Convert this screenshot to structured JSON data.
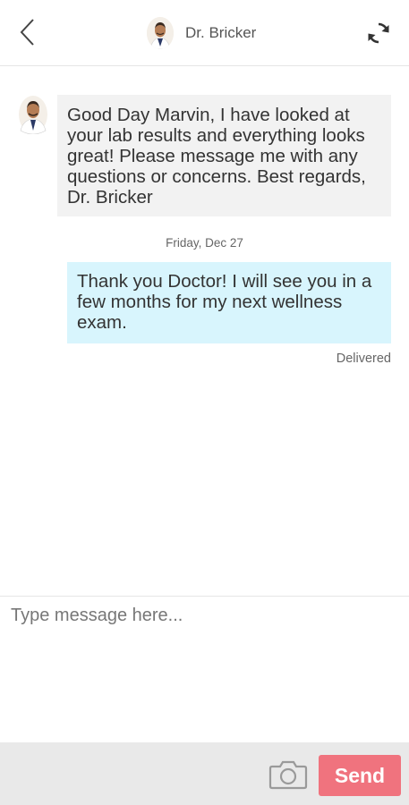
{
  "header": {
    "title": "Dr. Bricker",
    "back_icon": "chevron-left-icon",
    "refresh_icon": "refresh-icon"
  },
  "messages": [
    {
      "direction": "incoming",
      "text": "Good Day Marvin, I have looked at your lab results and everything looks great! Please message me with any questions or concerns. Best regards, Dr. Bricker"
    },
    {
      "direction": "outgoing",
      "text": "Thank you Doctor! I will see you in a few months for my next wellness exam."
    }
  ],
  "date_separator": "Friday, Dec 27",
  "status": "Delivered",
  "composer": {
    "placeholder": "Type message here...",
    "value": ""
  },
  "toolbar": {
    "camera_icon": "camera-icon",
    "send_label": "Send"
  },
  "colors": {
    "incoming_bubble": "#f2f2f2",
    "outgoing_bubble": "#d8f5fd",
    "send_button": "#f0737e",
    "bottom_bar": "#e9e9e9"
  }
}
